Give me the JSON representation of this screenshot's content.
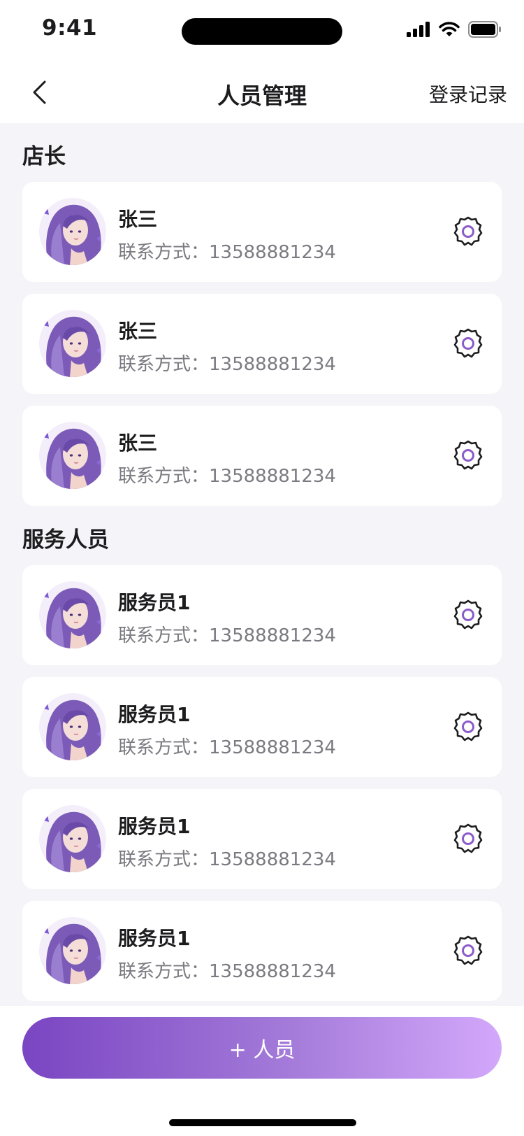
{
  "status_bar": {
    "time": "9:41"
  },
  "nav": {
    "title": "人员管理",
    "right_link": "登录记录"
  },
  "sections": [
    {
      "title": "店长",
      "members": [
        {
          "name": "张三",
          "contact": "联系方式：13588881234"
        },
        {
          "name": "张三",
          "contact": "联系方式：13588881234"
        },
        {
          "name": "张三",
          "contact": "联系方式：13588881234"
        }
      ]
    },
    {
      "title": "服务人员",
      "members": [
        {
          "name": "服务员1",
          "contact": "联系方式：13588881234"
        },
        {
          "name": "服务员1",
          "contact": "联系方式：13588881234"
        },
        {
          "name": "服务员1",
          "contact": "联系方式：13588881234"
        },
        {
          "name": "服务员1",
          "contact": "联系方式：13588881234"
        }
      ]
    }
  ],
  "add_button": {
    "label": "+ 人员"
  },
  "colors": {
    "accent_purple": "#8b5cc8",
    "button_gradient_start": "#7a45c2",
    "button_gradient_end": "#d3a8fb",
    "page_background": "#f5f5f9"
  },
  "icons": {
    "back": "chevron-left-icon",
    "settings": "gear-icon",
    "signal": "signal-icon",
    "wifi": "wifi-icon",
    "battery": "battery-icon"
  }
}
